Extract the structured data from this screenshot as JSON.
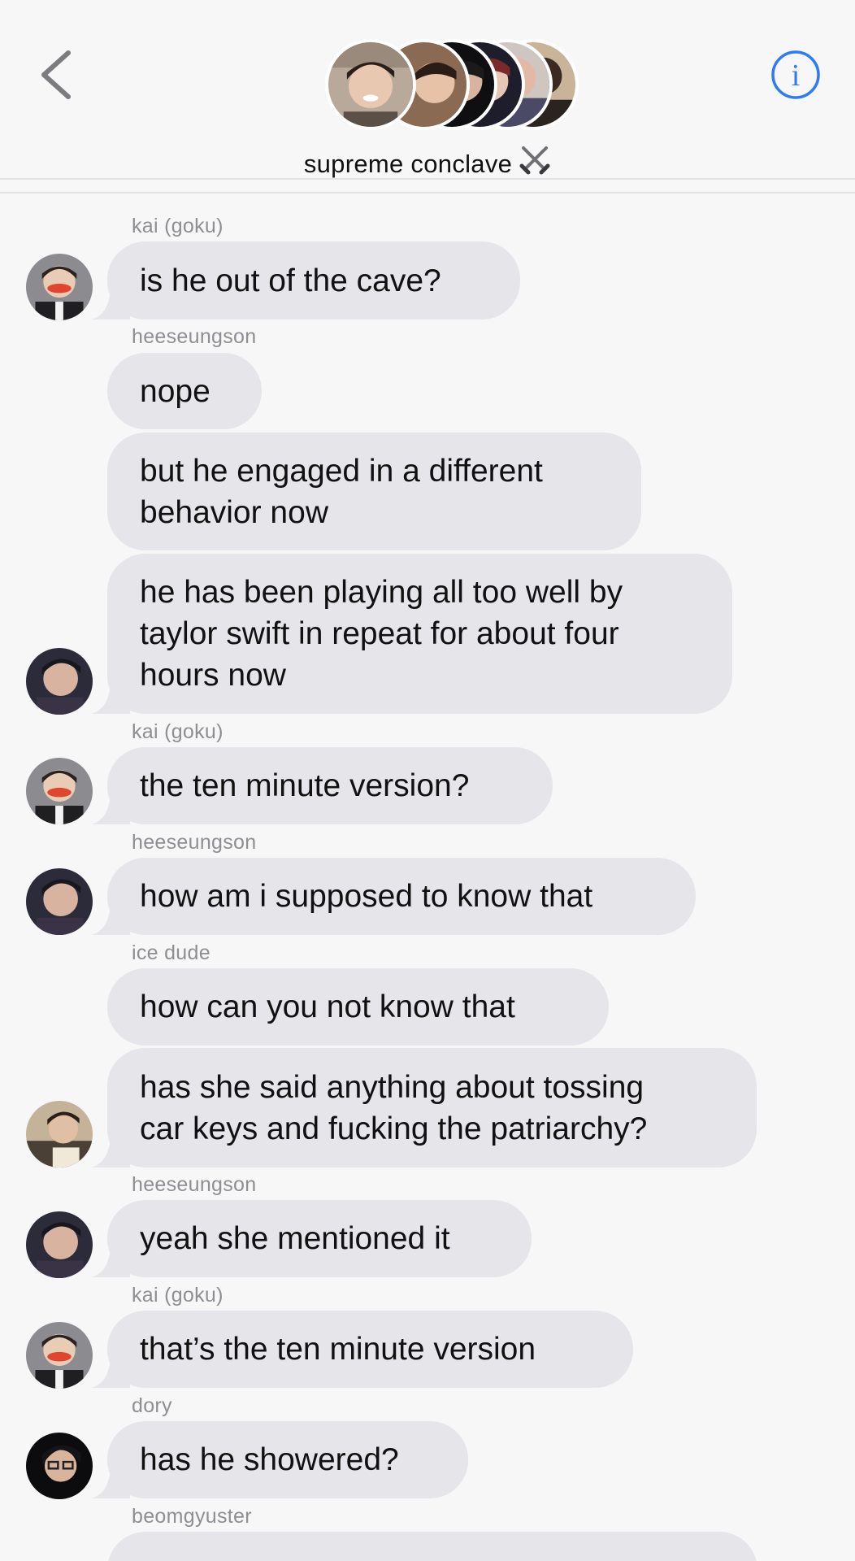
{
  "header": {
    "title": "supreme conclave",
    "title_emoji": "⚔️",
    "back_icon": "chevron-left-icon",
    "info_icon": "info-circle-icon",
    "info_glyph": "i",
    "accent_color": "#2f7bf6"
  },
  "messages": [
    {
      "sender": "kai (goku)",
      "text": [
        "is he out of the cave?"
      ]
    },
    {
      "sender": "heeseungson",
      "text": [
        "nope"
      ]
    },
    {
      "sender": "",
      "text": [
        "but he engaged in a different",
        "behavior now"
      ]
    },
    {
      "sender": "",
      "text": [
        "he has been playing all too well by",
        "taylor swift in repeat for about four",
        "hours now"
      ]
    },
    {
      "sender": "kai (goku)",
      "text": [
        "the ten minute version?"
      ]
    },
    {
      "sender": "heeseungson",
      "text": [
        "how am i supposed to know that"
      ]
    },
    {
      "sender": "ice dude",
      "text": [
        "how can you not know that"
      ]
    },
    {
      "sender": "",
      "text": [
        "has she said anything about tossing",
        "car keys and fucking the patriarchy?"
      ]
    },
    {
      "sender": "heeseungson",
      "text": [
        "yeah she mentioned it"
      ]
    },
    {
      "sender": "kai (goku)",
      "text": [
        "that’s the ten minute version"
      ]
    },
    {
      "sender": "dory",
      "text": [
        "has he showered?"
      ]
    },
    {
      "sender": "beomgyuster",
      "text": [
        ""
      ]
    }
  ],
  "colors": {
    "background": "#f7f7f8",
    "bubble": "#e5e5ea",
    "sender_name": "#8e8e93",
    "message_text": "#111111"
  }
}
